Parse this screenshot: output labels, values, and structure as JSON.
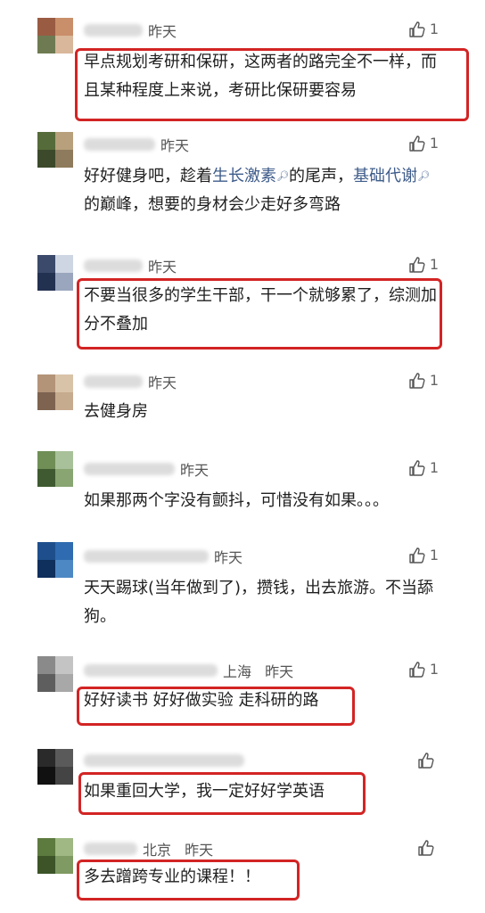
{
  "comments": [
    {
      "time": "昨天",
      "likes": "1",
      "text": "早点规划考研和保研，这两者的路完全不一样，而且某种程度上来说，考研比保研要容易"
    },
    {
      "time": "昨天",
      "likes": "1",
      "text_parts": {
        "p1": "好好健身吧，趁着",
        "link1": "生长激素",
        "p2": "的尾声，",
        "link2": "基础代谢",
        "p3": "的巅峰，想要的身材会少走好多弯路"
      }
    },
    {
      "time": "昨天",
      "likes": "1",
      "text": "不要当很多的学生干部，干一个就够累了，综测加分不叠加"
    },
    {
      "time": "昨天",
      "likes": "1",
      "text": "去健身房"
    },
    {
      "time": "昨天",
      "likes": "1",
      "text": "如果那两个字没有颤抖，可惜没有如果。。。"
    },
    {
      "time": "昨天",
      "likes": "1",
      "text": "天天踢球(当年做到了)，攒钱，出去旅游。不当舔狗。"
    },
    {
      "time": "昨天",
      "location": "上海",
      "likes": "1",
      "text": "好好读书 好好做实验 走科研的路"
    },
    {
      "time": "",
      "likes": "",
      "text": "如果重回大学，我一定好好学英语"
    },
    {
      "time": "昨天",
      "location": "北京",
      "likes": "",
      "text": "多去蹭跨专业的课程！！"
    }
  ],
  "colors": {
    "highlight_box": "#d32424",
    "link": "#3e5c8a"
  },
  "icons": {
    "like": "thumbs-up-icon",
    "search": "search-icon"
  }
}
